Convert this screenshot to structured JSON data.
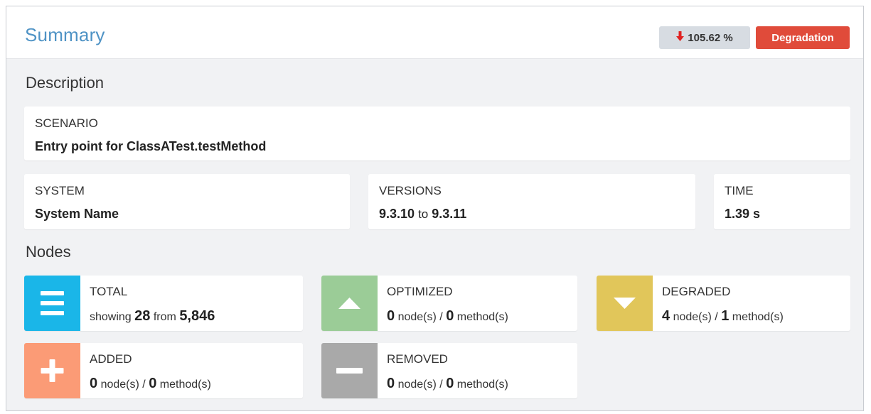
{
  "header": {
    "title": "Summary",
    "percent_badge": "105.62 %",
    "status_badge": "Degradation"
  },
  "description": {
    "title": "Description",
    "scenario": {
      "label": "SCENARIO",
      "value": "Entry point for ClassATest.testMethod"
    },
    "system": {
      "label": "SYSTEM",
      "value": "System Name"
    },
    "versions": {
      "label": "VERSIONS",
      "from": "9.3.10",
      "joiner": "to",
      "to": "9.3.11"
    },
    "time": {
      "label": "TIME",
      "value": "1.39 s"
    }
  },
  "nodes": {
    "title": "Nodes",
    "total": {
      "label": "TOTAL",
      "prefix": "showing",
      "shown": "28",
      "middle": "from",
      "total": "5,846",
      "icon": "list-icon"
    },
    "optimized": {
      "label": "OPTIMIZED",
      "nodes": "0",
      "nodes_unit": "node(s)",
      "sep": "/",
      "methods": "0",
      "methods_unit": "method(s)",
      "icon": "triangle-up-icon"
    },
    "degraded": {
      "label": "DEGRADED",
      "nodes": "4",
      "nodes_unit": "node(s)",
      "sep": "/",
      "methods": "1",
      "methods_unit": "method(s)",
      "icon": "triangle-down-icon"
    },
    "added": {
      "label": "ADDED",
      "nodes": "0",
      "nodes_unit": "node(s)",
      "sep": "/",
      "methods": "0",
      "methods_unit": "method(s)",
      "icon": "plus-icon"
    },
    "removed": {
      "label": "REMOVED",
      "nodes": "0",
      "nodes_unit": "node(s)",
      "sep": "/",
      "methods": "0",
      "methods_unit": "method(s)",
      "icon": "minus-icon"
    }
  },
  "colors": {
    "title": "#4f93c5",
    "degradation": "#e04b3a",
    "total_tile": "#1ab6e8",
    "optimized_tile": "#9bcc97",
    "degraded_tile": "#e1c65a",
    "added_tile": "#fb9b76",
    "removed_tile": "#a9a9a9"
  }
}
